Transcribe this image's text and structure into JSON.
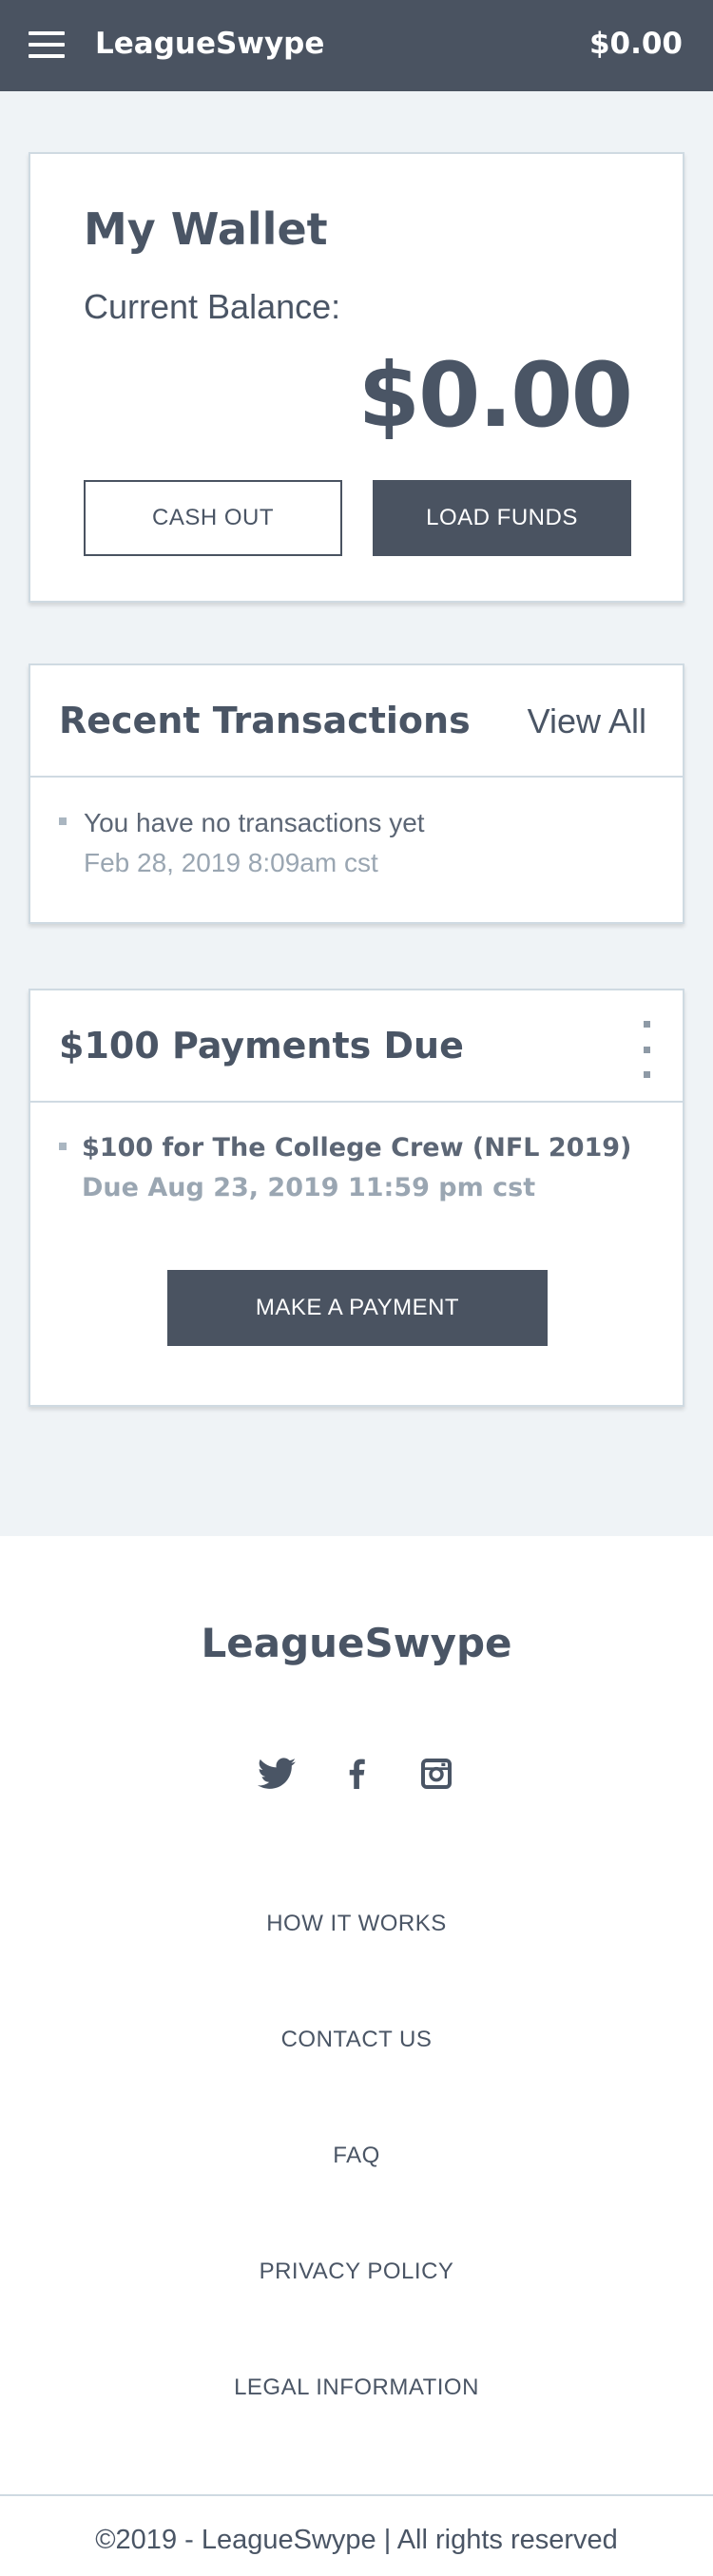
{
  "header": {
    "brand": "LeagueSwype",
    "balance": "$0.00"
  },
  "wallet": {
    "title": "My Wallet",
    "balance_label": "Current Balance:",
    "balance_amount": "$0.00",
    "cash_out_label": "CASH OUT",
    "load_funds_label": "LOAD FUNDS"
  },
  "transactions": {
    "title": "Recent Transactions",
    "view_all_label": "View All",
    "items": [
      {
        "text": "You have no transactions yet",
        "timestamp": "Feb 28, 2019 8:09am cst"
      }
    ]
  },
  "payments": {
    "title": "$100 Payments Due",
    "items": [
      {
        "text": "$100 for The College Crew (NFL 2019)",
        "due": "Due Aug 23, 2019 11:59 pm cst"
      }
    ],
    "make_payment_label": "MAKE A PAYMENT"
  },
  "footer": {
    "brand": "LeagueSwype",
    "social_icons": [
      "twitter-icon",
      "facebook-icon",
      "instagram-icon"
    ],
    "links": [
      "HOW IT WORKS",
      "CONTACT US",
      "FAQ",
      "PRIVACY POLICY",
      "LEGAL INFORMATION"
    ],
    "copyright": "©2019 - LeagueSwype | All rights reserved"
  },
  "colors": {
    "header_bg": "#4a5361",
    "page_bg": "#eff3f6",
    "text": "#4a5565",
    "muted": "#9aa6b2"
  }
}
